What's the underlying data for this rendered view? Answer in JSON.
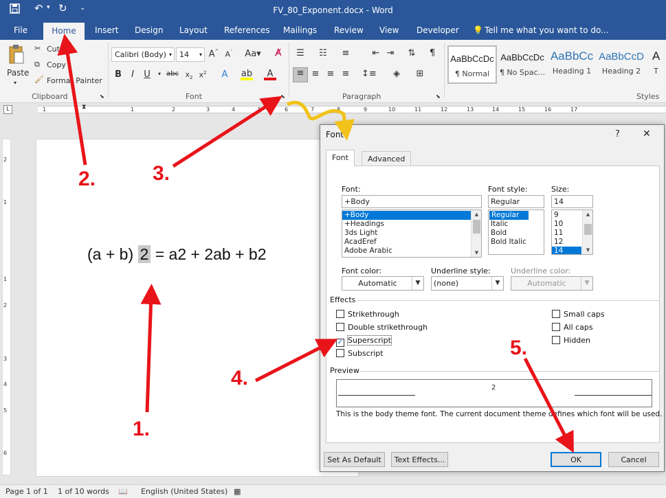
{
  "window": {
    "title": "FV_80_Exponent.docx - Word"
  },
  "quick_access": {
    "save": "save-icon",
    "undo": "undo-icon",
    "redo": "redo-icon",
    "customize": "⌄"
  },
  "tabs": [
    "File",
    "Home",
    "Insert",
    "Design",
    "Layout",
    "References",
    "Mailings",
    "Review",
    "View",
    "Developer"
  ],
  "tell_me": "Tell me what you want to do...",
  "ribbon": {
    "clipboard": {
      "paste": "Paste",
      "cut": "Cut",
      "copy": "Copy",
      "format_painter": "Format Painter",
      "label": "Clipboard"
    },
    "font": {
      "name": "Calibri (Body)",
      "size": "14",
      "label": "Font"
    },
    "paragraph": {
      "label": "Paragraph"
    },
    "styles": {
      "label": "Styles",
      "items": [
        {
          "preview": "AaBbCcDc",
          "name": "¶ Normal"
        },
        {
          "preview": "AaBbCcDc",
          "name": "¶ No Spac..."
        },
        {
          "preview": "AaBbCc",
          "name": "Heading 1"
        },
        {
          "preview": "AaBbCcD",
          "name": "Heading 2"
        },
        {
          "preview": "A",
          "name": "T"
        }
      ]
    }
  },
  "ruler_numbers": [
    "1",
    "1",
    "2",
    "3",
    "4",
    "5",
    "6",
    "7",
    "8",
    "9",
    "10",
    "11",
    "12",
    "13",
    "14",
    "15",
    "16",
    "17"
  ],
  "vruler_numbers": [
    "2",
    "1",
    "1",
    "2",
    "3",
    "4",
    "5",
    "6"
  ],
  "document": {
    "eq_before": "(a + b) ",
    "eq_highlight": "2",
    "eq_after": " = a2 + 2ab + b2"
  },
  "status": {
    "page": "Page 1 of 1",
    "words": "1 of 10 words",
    "language": "English (United States)"
  },
  "dialog": {
    "title": "Font",
    "help": "?",
    "close": "✕",
    "tabs": [
      "Font",
      "Advanced"
    ],
    "font_label": "Font:",
    "font_value": "+Body",
    "font_list": [
      "+Body",
      "+Headings",
      "3ds Light",
      "AcadEref",
      "Adobe Arabic"
    ],
    "style_label": "Font style:",
    "style_value": "Regular",
    "style_list": [
      "Regular",
      "Italic",
      "Bold",
      "Bold Italic"
    ],
    "size_label": "Size:",
    "size_value": "14",
    "size_list": [
      "9",
      "10",
      "11",
      "12",
      "14"
    ],
    "font_color_label": "Font color:",
    "font_color_value": "Automatic",
    "underline_style_label": "Underline style:",
    "underline_style_value": "(none)",
    "underline_color_label": "Underline color:",
    "underline_color_value": "Automatic",
    "effects_label": "Effects",
    "effects_left": [
      {
        "label": "Strikethrough",
        "checked": false
      },
      {
        "label": "Double strikethrough",
        "checked": false
      },
      {
        "label": "Superscript",
        "checked": true
      },
      {
        "label": "Subscript",
        "checked": false
      }
    ],
    "effects_right": [
      {
        "label": "Small caps",
        "checked": false
      },
      {
        "label": "All caps",
        "checked": false
      },
      {
        "label": "Hidden",
        "checked": false
      }
    ],
    "preview_label": "Preview",
    "preview_text": "2",
    "preview_note": "This is the body theme font. The current document theme defines which font will be used.",
    "set_default": "Set As Default",
    "text_effects": "Text Effects...",
    "ok": "OK",
    "cancel": "Cancel"
  },
  "annotations": [
    "1.",
    "2.",
    "3.",
    "4.",
    "5."
  ],
  "colors": {
    "ribbon_blue": "#2b579a",
    "arrow_red": "#e8141a",
    "arrow_yellow": "#f2c21b",
    "selection": "#0078d7"
  }
}
